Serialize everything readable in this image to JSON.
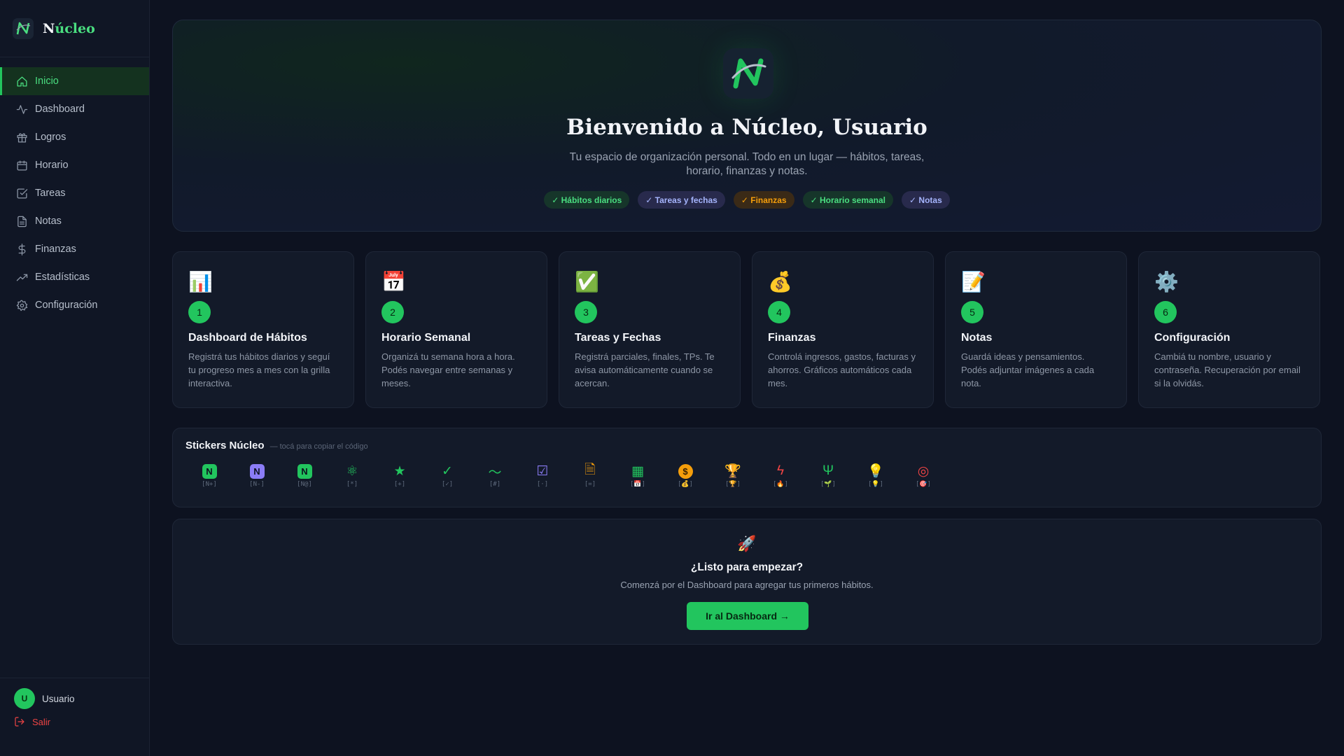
{
  "brand": {
    "name_first": "N",
    "name_rest": "úcleo"
  },
  "sidebar": {
    "items": [
      {
        "label": "Inicio",
        "icon": "home-icon",
        "active": true
      },
      {
        "label": "Dashboard",
        "icon": "activity-icon"
      },
      {
        "label": "Logros",
        "icon": "trophy-icon"
      },
      {
        "label": "Horario",
        "icon": "calendar-icon"
      },
      {
        "label": "Tareas",
        "icon": "check-square-icon"
      },
      {
        "label": "Notas",
        "icon": "file-icon"
      },
      {
        "label": "Finanzas",
        "icon": "dollar-icon"
      },
      {
        "label": "Estadísticas",
        "icon": "trending-up-icon"
      },
      {
        "label": "Configuración",
        "icon": "gear-icon"
      }
    ],
    "user": {
      "initial": "U",
      "name": "Usuario"
    },
    "logout_label": "Salir"
  },
  "hero": {
    "title": "Bienvenido a Núcleo, Usuario",
    "subtitle": "Tu espacio de organización personal. Todo en un lugar — hábitos, tareas, horario, finanzas y notas.",
    "tags": [
      {
        "label": "✓ Hábitos diarios",
        "tone": "green"
      },
      {
        "label": "✓ Tareas y fechas",
        "tone": "purple"
      },
      {
        "label": "✓ Finanzas",
        "tone": "orange"
      },
      {
        "label": "✓ Horario semanal",
        "tone": "green"
      },
      {
        "label": "✓ Notas",
        "tone": "purple"
      }
    ]
  },
  "cards": [
    {
      "icon": "📊",
      "number": "1",
      "title": "Dashboard de Hábitos",
      "desc": "Registrá tus hábitos diarios y seguí tu progreso mes a mes con la grilla interactiva."
    },
    {
      "icon": "📅",
      "number": "2",
      "title": "Horario Semanal",
      "desc": "Organizá tu semana hora a hora. Podés navegar entre semanas y meses."
    },
    {
      "icon": "✅",
      "number": "3",
      "title": "Tareas y Fechas",
      "desc": "Registrá parciales, finales, TPs. Te avisa automáticamente cuando se acercan."
    },
    {
      "icon": "💰",
      "number": "4",
      "title": "Finanzas",
      "desc": "Controlá ingresos, gastos, facturas y ahorros. Gráficos automáticos cada mes."
    },
    {
      "icon": "📝",
      "number": "5",
      "title": "Notas",
      "desc": "Guardá ideas y pensamientos. Podés adjuntar imágenes a cada nota."
    },
    {
      "icon": "⚙️",
      "number": "6",
      "title": "Configuración",
      "desc": "Cambiá tu nombre, usuario y contraseña. Recuperación por email si la olvidás."
    }
  ],
  "stickers": {
    "title": "Stickers Núcleo",
    "hint": "— tocá para copiar el código",
    "items": [
      {
        "glyph": "N",
        "kind": "box",
        "color": "#22c55e",
        "code": "[N+]",
        "icon": "n-green-icon"
      },
      {
        "glyph": "N",
        "kind": "box",
        "color": "#8b7cf6",
        "code": "[N-]",
        "icon": "n-purple-icon"
      },
      {
        "glyph": "N",
        "kind": "box",
        "color": "#22c55e",
        "code": "[N@]",
        "icon": "n-green-alt-icon"
      },
      {
        "glyph": "⚛",
        "kind": "text",
        "color": "#22c55e",
        "code": "[*]",
        "icon": "atom-icon"
      },
      {
        "glyph": "★",
        "kind": "text",
        "color": "#22c55e",
        "code": "[+]",
        "icon": "star-icon"
      },
      {
        "glyph": "✓",
        "kind": "text",
        "color": "#22c55e",
        "code": "[✓]",
        "icon": "check-icon"
      },
      {
        "glyph": "〜",
        "kind": "text",
        "color": "#22c55e",
        "code": "[#]",
        "icon": "pulse-icon"
      },
      {
        "glyph": "☑",
        "kind": "text",
        "color": "#8b7cf6",
        "code": "[·]",
        "icon": "checkbox-icon"
      },
      {
        "glyph": "🗎",
        "kind": "text",
        "color": "#f59e0b",
        "code": "[=]",
        "icon": "document-icon"
      },
      {
        "glyph": "▦",
        "kind": "text",
        "color": "#22c55e",
        "code": "[📅]",
        "icon": "calendar-icon"
      },
      {
        "glyph": "$",
        "kind": "coin",
        "color": "#f59e0b",
        "code": "[💰]",
        "icon": "coin-icon"
      },
      {
        "glyph": "🏆",
        "kind": "text",
        "color": "#f59e0b",
        "code": "[🏆]",
        "icon": "trophy-icon"
      },
      {
        "glyph": "ϟ",
        "kind": "text",
        "color": "#ef4444",
        "code": "[🔥]",
        "icon": "bolt-icon"
      },
      {
        "glyph": "Ψ",
        "kind": "text",
        "color": "#22c55e",
        "code": "[🌱]",
        "icon": "sprout-icon"
      },
      {
        "glyph": "💡",
        "kind": "text",
        "color": "#8b7cf6",
        "code": "[💡]",
        "icon": "lightbulb-icon"
      },
      {
        "glyph": "◎",
        "kind": "text",
        "color": "#ef4444",
        "code": "[🎯]",
        "icon": "target-icon"
      }
    ]
  },
  "cta": {
    "icon": "🚀",
    "title": "¿Listo para empezar?",
    "subtitle": "Comenzá por el Dashboard para agregar tus primeros hábitos.",
    "button": "Ir al Dashboard →"
  },
  "colors": {
    "accent": "#22c55e",
    "danger": "#ef4444",
    "background": "#0d1220"
  }
}
